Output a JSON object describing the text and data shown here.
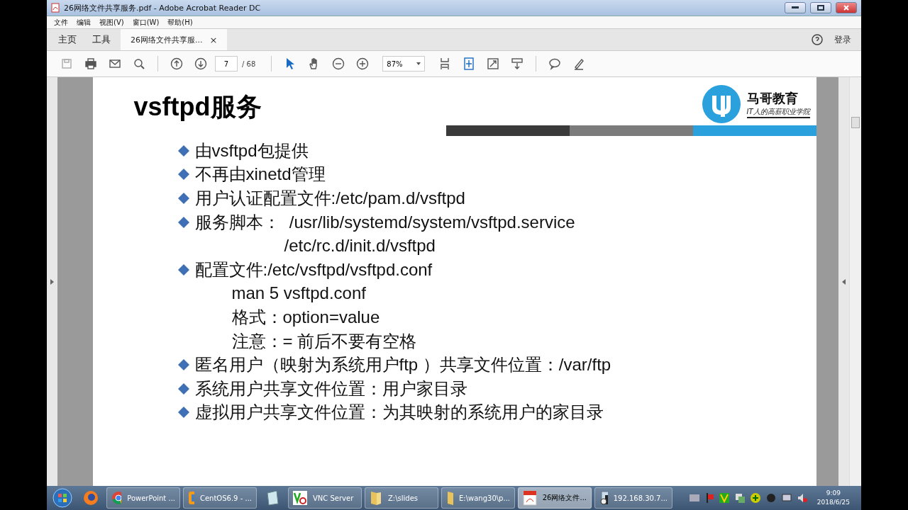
{
  "window": {
    "title": "26网络文件共享服务.pdf - Adobe Acrobat Reader DC"
  },
  "menu": [
    "文件",
    "编辑",
    "视图(V)",
    "窗口(W)",
    "帮助(H)"
  ],
  "tabs": [
    {
      "label": "主页",
      "selected": false,
      "kind": "nav"
    },
    {
      "label": "工具",
      "selected": false,
      "kind": "nav"
    },
    {
      "label": "26网络文件共享服...",
      "selected": true,
      "kind": "doc",
      "close": "×"
    }
  ],
  "login": "登录",
  "toolbar": {
    "page_number": "7",
    "page_total": "/ 68",
    "zoom": "87%"
  },
  "slide": {
    "title": "vsftpd服务",
    "logo": {
      "name": "马哥教育",
      "tagline": "IT人的高薪职业学院"
    },
    "lines": [
      {
        "kind": "bullet",
        "text": "由vsftpd包提供"
      },
      {
        "kind": "bullet",
        "text": "不再由xinetd管理"
      },
      {
        "kind": "bullet",
        "text": "用户认证配置文件:/etc/pam.d/vsftpd"
      },
      {
        "kind": "bullet",
        "text": "服务脚本：  /usr/lib/systemd/system/vsftpd.service"
      },
      {
        "kind": "continuation",
        "text": "/etc/rc.d/init.d/vsftpd"
      },
      {
        "kind": "bullet",
        "text": "配置文件:/etc/vsftpd/vsftpd.conf"
      },
      {
        "kind": "sub",
        "text": "man 5 vsftpd.conf"
      },
      {
        "kind": "sub",
        "text": "格式：option=value"
      },
      {
        "kind": "sub",
        "text": "注意：= 前后不要有空格"
      },
      {
        "kind": "bullet",
        "text": "匿名用户（映射为系统用户ftp ）共享文件位置：/var/ftp"
      },
      {
        "kind": "bullet",
        "text": "系统用户共享文件位置：用户家目录"
      },
      {
        "kind": "bullet",
        "text": "虚拟用户共享文件位置：为其映射的系统用户的家目录"
      }
    ]
  },
  "taskbar": [
    {
      "kind": "start"
    },
    {
      "kind": "firefox"
    },
    {
      "kind": "chrome",
      "label": "PowerPoint ...",
      "selected": false
    },
    {
      "kind": "vm",
      "label": "CentOS6.9 - ...",
      "selected": false
    },
    {
      "kind": "notepad"
    },
    {
      "kind": "vnc",
      "label": "VNC Server",
      "selected": false
    },
    {
      "kind": "folder",
      "label": "Z:\\slides",
      "selected": false
    },
    {
      "kind": "folder",
      "label": "E:\\wang30\\p...",
      "selected": false
    },
    {
      "kind": "pdf",
      "label": "26网络文件...",
      "selected": true
    },
    {
      "kind": "remote",
      "label": "192.168.30.7...",
      "selected": false
    }
  ],
  "clock": {
    "time": "9:09",
    "date": "2018/6/25"
  }
}
